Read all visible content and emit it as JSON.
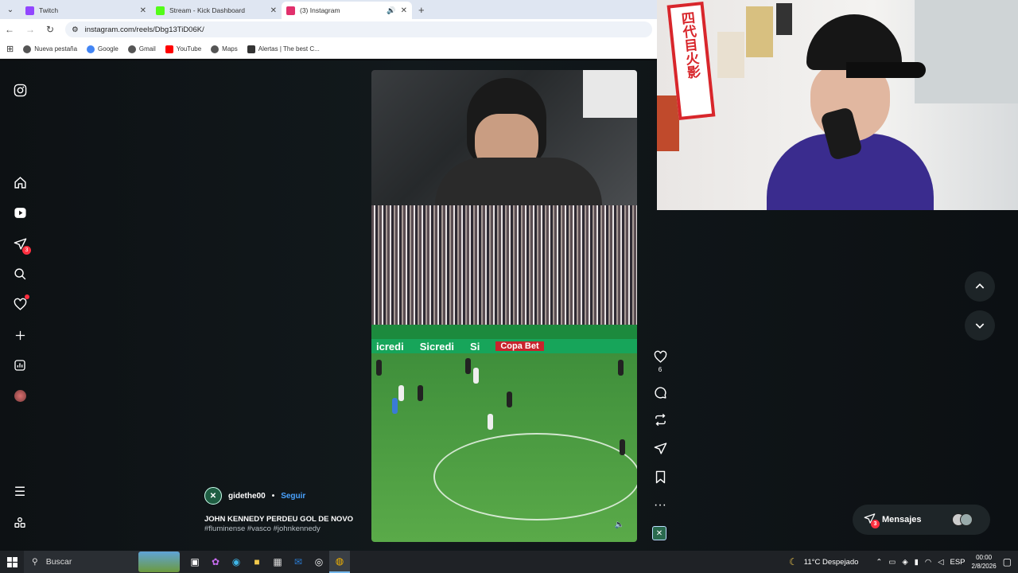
{
  "browser": {
    "tabs": [
      {
        "title": "Twitch",
        "favicon_color": "#9146ff",
        "active": false
      },
      {
        "title": "Stream - Kick Dashboard",
        "favicon_color": "#53fc18",
        "active": false
      },
      {
        "title": "(3) Instagram",
        "favicon_color": "#e1306c",
        "active": true
      }
    ],
    "url": "instagram.com/reels/Dbg13TiD06K/",
    "bookmarks": [
      {
        "label": "Nueva pestaña",
        "icon": "globe-icon"
      },
      {
        "label": "Google",
        "icon": "google-icon"
      },
      {
        "label": "Gmail",
        "icon": "globe-icon"
      },
      {
        "label": "YouTube",
        "icon": "youtube-icon"
      },
      {
        "label": "Maps",
        "icon": "globe-icon"
      },
      {
        "label": "Alertas | The best C...",
        "icon": "globe-icon"
      }
    ]
  },
  "instagram": {
    "nav": {
      "messages_badge": "3"
    },
    "reel": {
      "username": "gidethe00",
      "separator": "•",
      "follow_label": "Seguir",
      "caption": "JOHN KENNEDY PERDEU GOL DE NOVO",
      "hashtags": "#fluminense #vasco #johnkennedy",
      "ad_boards": [
        "icredi",
        "Sicredi",
        "Si",
        "Copa Bet"
      ],
      "likes": "6"
    },
    "messages": {
      "label": "Mensajes",
      "badge": "3"
    }
  },
  "webcam": {
    "banner_text": "四代目火影"
  },
  "taskbar": {
    "search_placeholder": "Buscar",
    "weather": "11°C  Despejado",
    "language": "ESP",
    "time": "00:00",
    "date": "2/8/2026"
  }
}
